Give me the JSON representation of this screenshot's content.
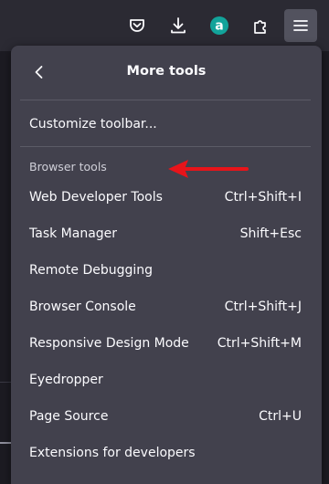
{
  "toolbar": {
    "buttons": [
      {
        "name": "pocket-icon"
      },
      {
        "name": "download-icon"
      },
      {
        "name": "extension-avatar-icon",
        "letter": "a",
        "color": "#12a39a"
      },
      {
        "name": "extensions-icon"
      },
      {
        "name": "menu-icon",
        "active": true
      }
    ]
  },
  "panel": {
    "title": "More tools",
    "back_icon": "chevron-left-icon",
    "customize": "Customize toolbar...",
    "section_label": "Browser tools",
    "items": [
      {
        "label": "Web Developer Tools",
        "shortcut": "Ctrl+Shift+I"
      },
      {
        "label": "Task Manager",
        "shortcut": "Shift+Esc"
      },
      {
        "label": "Remote Debugging",
        "shortcut": ""
      },
      {
        "label": "Browser Console",
        "shortcut": "Ctrl+Shift+J"
      },
      {
        "label": "Responsive Design Mode",
        "shortcut": "Ctrl+Shift+M"
      },
      {
        "label": "Eyedropper",
        "shortcut": ""
      },
      {
        "label": "Page Source",
        "shortcut": "Ctrl+U"
      },
      {
        "label": "Extensions for developers",
        "shortcut": ""
      }
    ]
  },
  "annotation": {
    "arrow_color": "#e8141a"
  },
  "colors": {
    "toolbar_bg": "#2b2a33",
    "panel_bg": "#42414d",
    "text": "#fbfbfe",
    "active_button": "#52525e"
  }
}
